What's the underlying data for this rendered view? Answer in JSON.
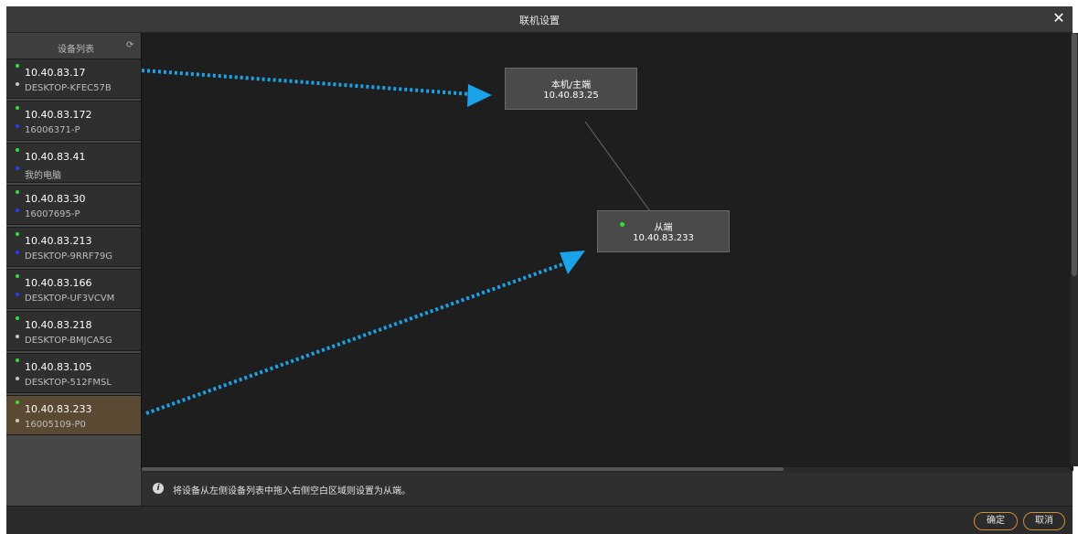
{
  "dialog": {
    "title": "联机设置",
    "close_icon": "close-icon"
  },
  "sidebar": {
    "title": "设备列表",
    "refresh_icon": "refresh-icon",
    "devices": [
      {
        "ip": "10.40.83.17",
        "host": "DESKTOP-KFEC57B",
        "dot2": "#c8c8c8",
        "selected": false
      },
      {
        "ip": "10.40.83.172",
        "host": "16006371-P",
        "dot2": "#2a3cff",
        "selected": false
      },
      {
        "ip": "10.40.83.41",
        "host": "我的电脑",
        "dot2": "#2a3cff",
        "selected": false
      },
      {
        "ip": "10.40.83.30",
        "host": "16007695-P",
        "dot2": "#2a3cff",
        "selected": false
      },
      {
        "ip": "10.40.83.213",
        "host": "DESKTOP-9RRF79G",
        "dot2": "#2a3cff",
        "selected": false
      },
      {
        "ip": "10.40.83.166",
        "host": "DESKTOP-UF3VCVM",
        "dot2": "#2a3cff",
        "selected": false
      },
      {
        "ip": "10.40.83.218",
        "host": "DESKTOP-BMJCA5G",
        "dot2": "#c8c8c8",
        "selected": false
      },
      {
        "ip": "10.40.83.105",
        "host": "DESKTOP-512FMSL",
        "dot2": "#c8c8c8",
        "selected": false
      },
      {
        "ip": "10.40.83.233",
        "host": "16005109-P0",
        "dot2": "#c8c8c8",
        "selected": true
      }
    ]
  },
  "canvas": {
    "master": {
      "label": "本机/主端",
      "ip": "10.40.83.25"
    },
    "slave": {
      "label": "从端",
      "ip": "10.40.83.233",
      "status_color": "#35e035"
    }
  },
  "info": {
    "text": "将设备从左侧设备列表中拖入右侧空白区域则设置为从端。",
    "icon": "info-icon"
  },
  "footer": {
    "ok": "确定",
    "cancel": "取消"
  },
  "colors": {
    "accent": "#d28b3a",
    "arrow": "#1aa3e8",
    "online": "#35e035"
  }
}
